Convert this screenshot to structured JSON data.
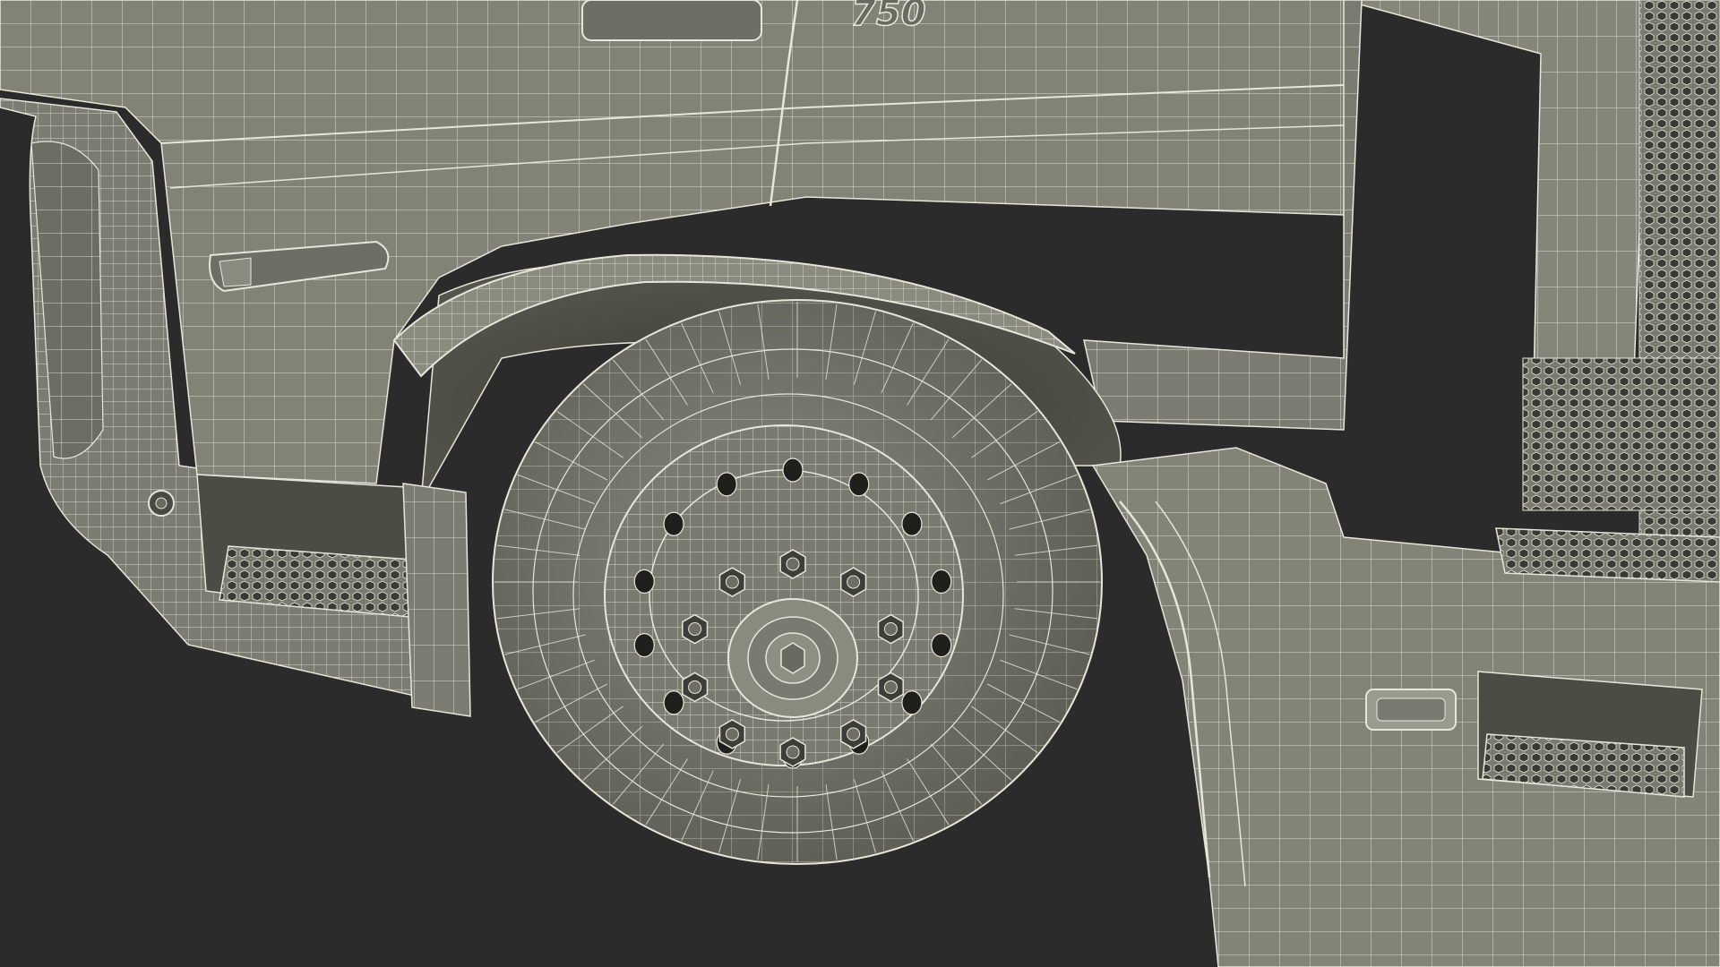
{
  "scene": {
    "badge_text": "750",
    "colors": {
      "background": "#2b2b2b",
      "surface": "#7f7f74",
      "surface_dark": "#5f5f56",
      "surface_light": "#9a9a8e",
      "wire": "#e6e6da",
      "tire": "#6e6e65"
    },
    "lug_nut_count": 10,
    "wheel_hole_count": 14
  }
}
